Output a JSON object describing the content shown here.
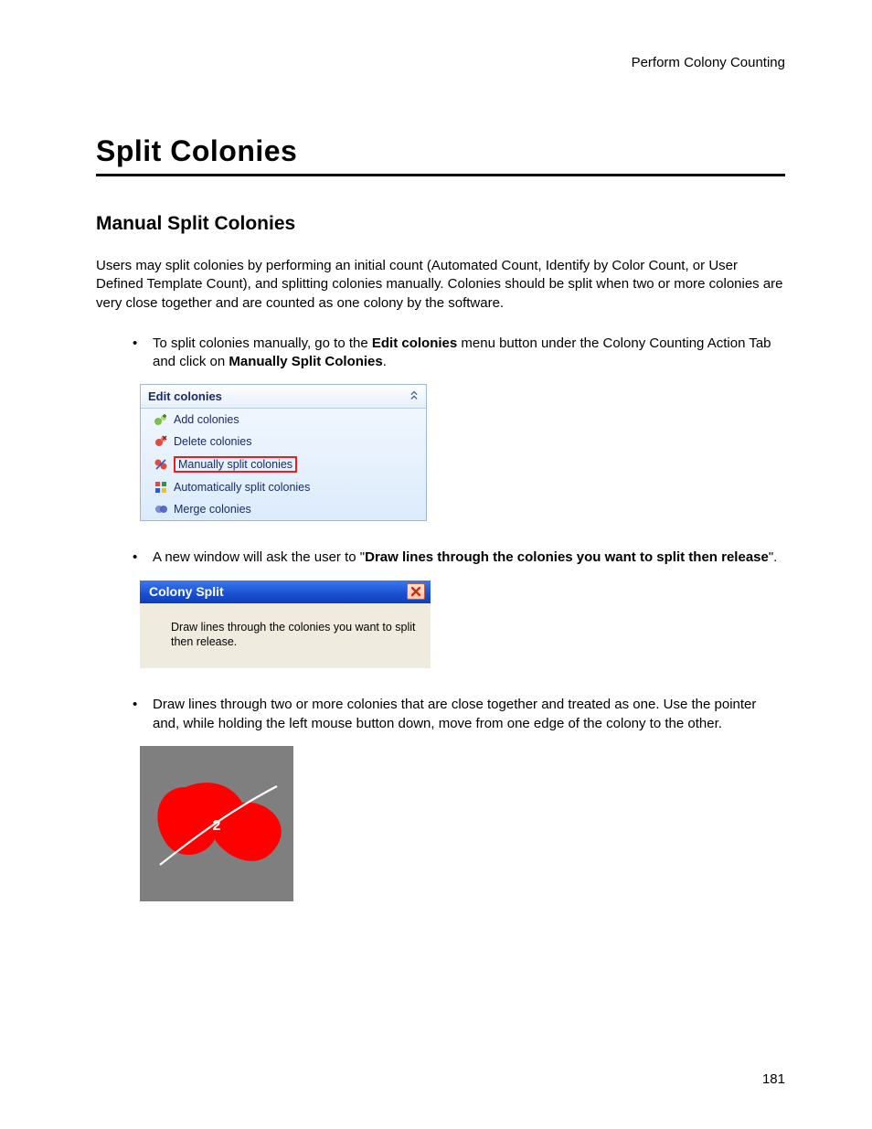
{
  "header": {
    "right": "Perform Colony Counting"
  },
  "title": "Split Colonies",
  "section": "Manual Split Colonies",
  "intro": "Users may split colonies by performing an initial count (Automated Count, Identify by Color Count, or User Defined Template Count), and splitting colonies manually. Colonies should be split when two or more colonies are very close together and are counted as one colony by the software.",
  "bullets": {
    "b1_pre": "To split colonies manually, go to the ",
    "b1_bold1": "Edit colonies",
    "b1_mid": " menu button under the Colony Counting Action Tab and click on ",
    "b1_bold2": "Manually Split Colonies",
    "b1_end": ".",
    "b2_pre": "A new window will ask the user to \"",
    "b2_bold": "Draw lines through the colonies you want to split then release",
    "b2_end": "\".",
    "b3": "Draw lines through two or more colonies that are close together and treated as one. Use the pointer and, while holding the left mouse button down, move from one edge of the colony to the other."
  },
  "panel": {
    "title": "Edit colonies",
    "items": {
      "add": "Add colonies",
      "delete": "Delete colonies",
      "manual": "Manually split colonies",
      "auto": "Automatically split colonies",
      "merge": "Merge colonies"
    }
  },
  "dialog": {
    "title": "Colony Split",
    "body": "Draw lines through the colonies you want to split then release."
  },
  "blob": {
    "label": "2"
  },
  "pageNumber": "181"
}
